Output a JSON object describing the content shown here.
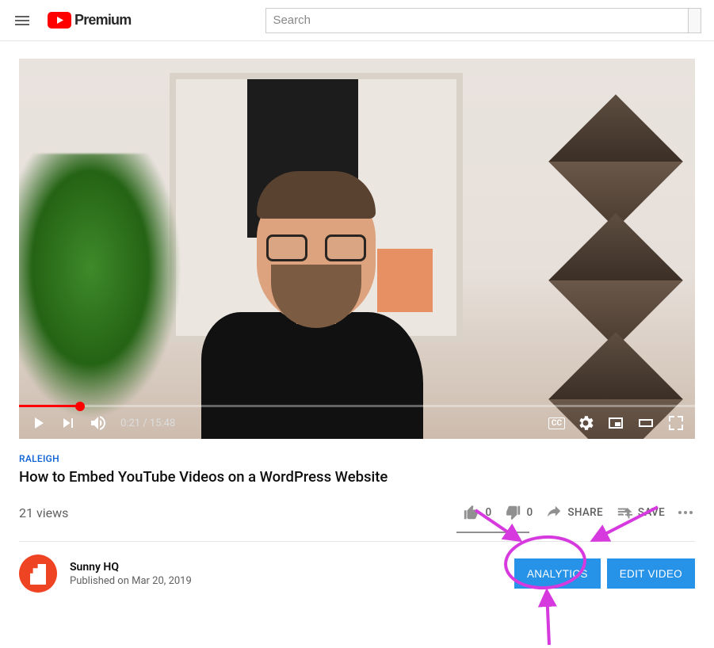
{
  "header": {
    "logo_text": "Premium",
    "search_placeholder": "Search"
  },
  "player": {
    "current_time": "0:21",
    "duration": "15:48",
    "time_display": "0:21 / 15:48",
    "cc_label": "CC"
  },
  "video": {
    "category": "RALEIGH",
    "title": "How to Embed YouTube Videos on a WordPress Website",
    "views": "21 views",
    "likes": "0",
    "dislikes": "0",
    "share_label": "SHARE",
    "save_label": "SAVE"
  },
  "channel": {
    "name": "Sunny HQ",
    "published": "Published on Mar 20, 2019",
    "analytics_label": "ANALYTICS",
    "edit_label": "EDIT VIDEO"
  }
}
